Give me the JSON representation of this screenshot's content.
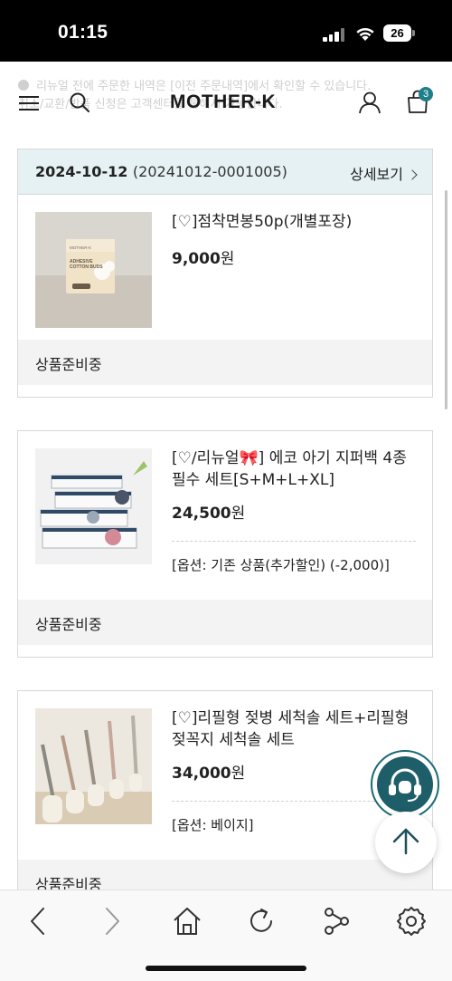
{
  "status_bar": {
    "time": "01:15",
    "battery": "26"
  },
  "notice": {
    "line1": "리뉴얼 전에 주문한 내역은 [이전 주문내역]에서 확인할 수 있습니다.",
    "line2": "취소/교환/반품 신청은 고객센터를 통해서 가능합니다."
  },
  "header": {
    "logo": "MOTHER-K",
    "cart_count": "3"
  },
  "order": {
    "date": "2024-10-12",
    "order_no": "(20241012-0001005)",
    "detail_label": "상세보기"
  },
  "items": [
    {
      "name": "[♡]점착면봉50p(개별포장)",
      "price": "9,000",
      "currency": "원",
      "option": "",
      "status": "상품준비중"
    },
    {
      "name": "[♡/리뉴얼🎀] 에코 아기 지퍼백 4종 필수 세트[S+M+L+XL]",
      "price": "24,500",
      "currency": "원",
      "option": "[옵션: 기존 상품(추가할인) (-2,000)]",
      "status": "상품준비중"
    },
    {
      "name": "[♡]리필형 젖병 세척솔 세트+리필형 젖꼭지 세척솔 세트",
      "price": "34,000",
      "currency": "원",
      "option": "[옵션: 베이지]",
      "status": "상품준비중"
    }
  ],
  "product_label": {
    "brand": "MOTHER-K",
    "line1": "ADHESIVE",
    "line2": "COTTON BUDS"
  },
  "colors": {
    "header_bg": "#e6f1f3",
    "accent": "#1e7f8a",
    "status_bg": "#f3f3f3"
  },
  "icons": [
    "menu-icon",
    "search-icon",
    "user-icon",
    "cart-icon",
    "chevron-right-icon",
    "headset-icon",
    "arrow-up-icon",
    "back-icon",
    "forward-icon",
    "home-icon",
    "refresh-icon",
    "share-icon",
    "settings-icon"
  ]
}
